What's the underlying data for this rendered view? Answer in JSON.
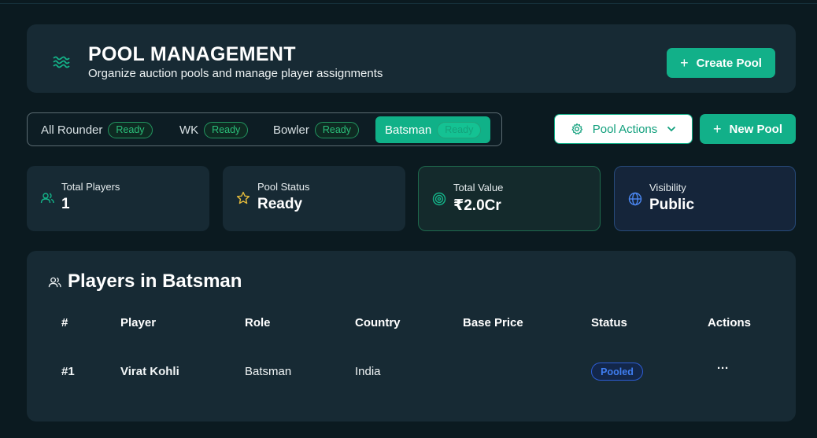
{
  "header": {
    "title": "POOL MANAGEMENT",
    "subtitle": "Organize auction pools and manage player assignments",
    "create_label": "Create Pool",
    "icon": "waves-icon"
  },
  "tabs": [
    {
      "label": "All Rounder",
      "badge": "Ready",
      "active": false
    },
    {
      "label": "WK",
      "badge": "Ready",
      "active": false
    },
    {
      "label": "Bowler",
      "badge": "Ready",
      "active": false
    },
    {
      "label": "Batsman",
      "badge": "Ready",
      "active": true
    }
  ],
  "toolbar": {
    "pool_actions_label": "Pool Actions",
    "new_pool_label": "New Pool"
  },
  "stats": [
    {
      "label": "Total Players",
      "value": "1",
      "icon": "users-icon"
    },
    {
      "label": "Pool Status",
      "value": "Ready",
      "icon": "star-icon"
    },
    {
      "label": "Total Value",
      "value": "₹2.0Cr",
      "icon": "target-icon"
    },
    {
      "label": "Visibility",
      "value": "Public",
      "icon": "globe-icon"
    }
  ],
  "players": {
    "title": "Players in Batsman",
    "columns": [
      "#",
      "Player",
      "Role",
      "Country",
      "Base Price",
      "Status",
      "Actions"
    ],
    "rows": [
      {
        "index": "#1",
        "player": "Virat Kohli",
        "role": "Batsman",
        "country": "India",
        "base_price": "",
        "status": "Pooled",
        "actions": "···"
      }
    ]
  },
  "colors": {
    "background": "#0b1a20",
    "card": "#172a34",
    "accent": "#12b089",
    "status_blue": "#3f7df0"
  }
}
